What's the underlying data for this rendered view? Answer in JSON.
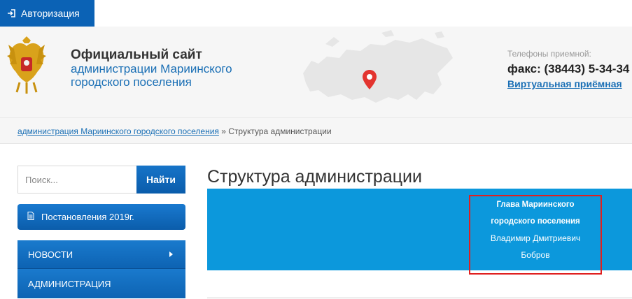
{
  "topbar": {
    "auth_label": "Авторизация"
  },
  "header": {
    "title_line1": "Официальный сайт",
    "title_line2": "администрации Мариинского",
    "title_line3": "городского поселения",
    "phones_label": "Телефоны приемной:",
    "fax": "факс: (38443) 5-34-34",
    "virtual_reception": "Виртуальная приёмная"
  },
  "breadcrumb": {
    "link": "администрация Мариинского городского поселения",
    "separator": " » ",
    "current": "Структура администрации"
  },
  "sidebar": {
    "search_placeholder": "Поиск...",
    "search_button": "Найти",
    "decree_button": "Постановления 2019г.",
    "menu": [
      {
        "label": "НОВОСТИ"
      },
      {
        "label": "АДМИНИСТРАЦИЯ"
      }
    ]
  },
  "main": {
    "title": "Структура администрации",
    "head_title_line1": "Глава Мариинского",
    "head_title_line2": "городского поселения",
    "head_name_line1": "Владимир Дмитриевич",
    "head_name_line2": "Бобров"
  },
  "colors": {
    "brand_blue": "#0b62b5",
    "banner_blue": "#0c98dc",
    "highlight_red": "#e02020",
    "link_blue": "#1a6fb5"
  },
  "icons": [
    "sign-in-icon",
    "coat-of-arms-icon",
    "russia-map-icon",
    "map-pin-icon",
    "document-icon",
    "chevron-right-icon"
  ]
}
